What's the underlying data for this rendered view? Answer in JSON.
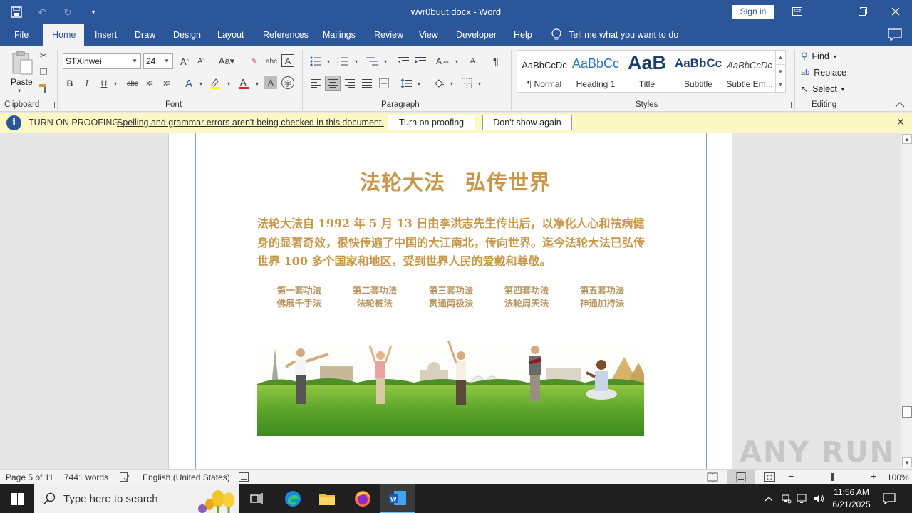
{
  "window": {
    "title": "wvr0buut.docx  -  Word",
    "sign_in": "Sign in"
  },
  "tabs": [
    "File",
    "Home",
    "Insert",
    "Draw",
    "Design",
    "Layout",
    "References",
    "Mailings",
    "Review",
    "View",
    "Developer",
    "Help"
  ],
  "tell_me": "Tell me what you want to do",
  "ribbon": {
    "clipboard": {
      "paste": "Paste",
      "label": "Clipboard"
    },
    "font": {
      "name": "STXinwei",
      "size": "24",
      "label": "Font"
    },
    "paragraph": {
      "label": "Paragraph"
    },
    "styles": {
      "label": "Styles",
      "items": [
        {
          "preview": "AaBbCcDc",
          "name": "¶ Normal"
        },
        {
          "preview": "AaBbCc",
          "name": "Heading 1"
        },
        {
          "preview": "AaB",
          "name": "Title"
        },
        {
          "preview": "AaBbCc",
          "name": "Subtitle"
        },
        {
          "preview": "AaBbCcDc",
          "name": "Subtle Em..."
        }
      ]
    },
    "editing": {
      "label": "Editing",
      "find": "Find",
      "replace": "Replace",
      "select": "Select"
    }
  },
  "proofing_bar": {
    "title": "TURN ON PROOFING",
    "message": "Spelling and grammar errors aren't being checked in this document.",
    "turn_on": "Turn on proofing",
    "dont_show": "Don't show again"
  },
  "document": {
    "heading_left": "法轮大法",
    "heading_right": "弘传世界",
    "paragraph": "法轮大法自 1992 年 5 月 13 日由李洪志先生传出后，以净化人心和祛病健身的显著奇效，很快传遍了中国的大江南北，传向世界。迄今法轮大法已弘传世界 100 多个国家和地区，受到世界人民的爱戴和尊敬。",
    "exercises": [
      {
        "line1": "第一套功法",
        "line2": "佛展千手法"
      },
      {
        "line1": "第二套功法",
        "line2": "法轮桩法"
      },
      {
        "line1": "第三套功法",
        "line2": "贯通两极法"
      },
      {
        "line1": "第四套功法",
        "line2": "法轮周天法"
      },
      {
        "line1": "第五套功法",
        "line2": "神通加持法"
      }
    ]
  },
  "status_bar": {
    "page": "Page 5 of 11",
    "words": "7441 words",
    "language": "English (United States)",
    "zoom": "100%"
  },
  "taskbar": {
    "search_placeholder": "Type here to search",
    "time": "11:56 AM",
    "date": "6/21/2025"
  },
  "watermark": "ANY RUN",
  "colors": {
    "word_blue": "#2b579a",
    "doc_text_gold": "#c7974a",
    "proofing_bg": "#fcf8c4"
  }
}
